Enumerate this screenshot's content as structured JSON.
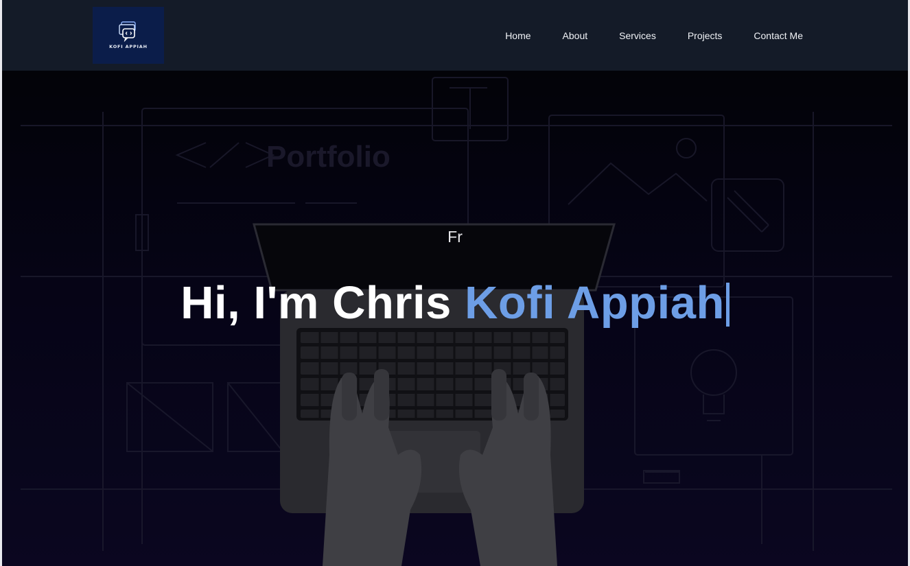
{
  "nav": {
    "logo_text": "KOFI APPIAH",
    "items": [
      {
        "label": "Home"
      },
      {
        "label": "About"
      },
      {
        "label": "Services"
      },
      {
        "label": "Projects"
      },
      {
        "label": "Contact Me"
      }
    ]
  },
  "hero": {
    "background_word": "Portfolio",
    "subtitle": "Fr",
    "greeting": "Hi, I'm Chris",
    "name_highlight": "Kofi Appiah",
    "accent_color": "#6d9ee6"
  }
}
